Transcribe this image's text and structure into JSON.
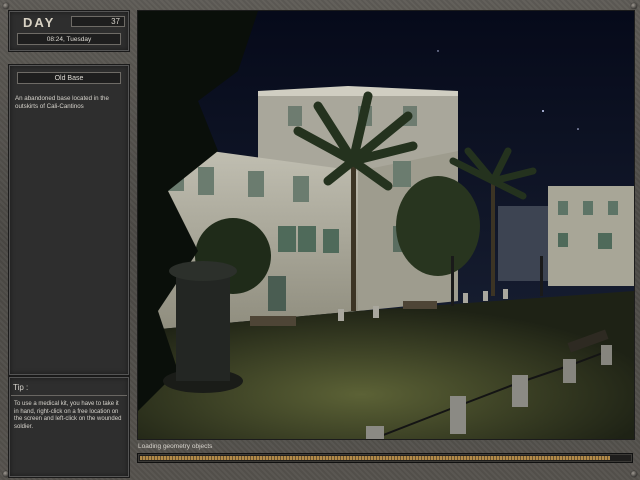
{
  "sidebar": {
    "day_label": "DAY",
    "day_number": "37",
    "time_date": "08:24, Tuesday",
    "location_name": "Old Base",
    "location_description": "An abandoned base located in the outskirts of Cali-Cantinos",
    "tip_title": "Tip :",
    "tip_text": "To use a medical kit, you have to take it in hand, right-click on a free location on the screen and left-click on the wounded soldier."
  },
  "loading": {
    "label": "Loading geometry objects",
    "progress": 0.96
  },
  "scene": {
    "description_icon": "night-town-square-scene",
    "colors": {
      "sky": "#0b1024",
      "ground": "#3b4028",
      "building": "#b9b7a9",
      "progress": "#b28a48"
    }
  }
}
